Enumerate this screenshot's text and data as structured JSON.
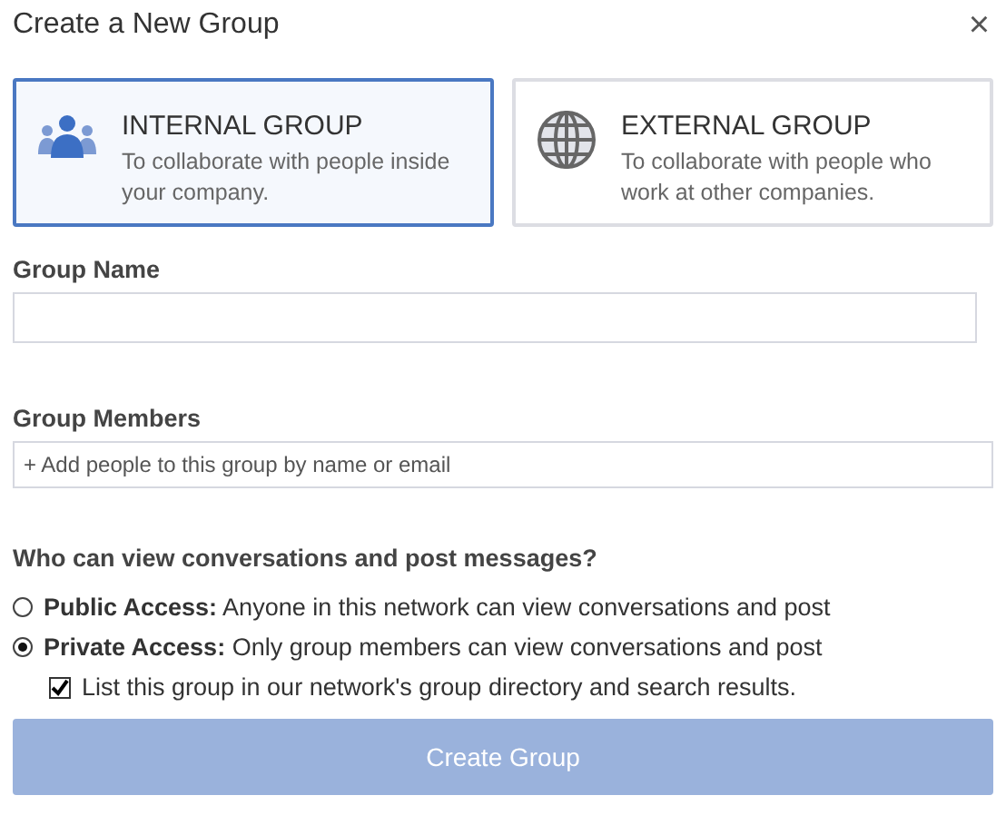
{
  "dialog": {
    "title": "Create a New Group",
    "close": "×"
  },
  "group_types": [
    {
      "kind": "people",
      "title": "INTERNAL GROUP",
      "description": "To collaborate with people inside your company.",
      "selected": true
    },
    {
      "kind": "globe",
      "title": "EXTERNAL GROUP",
      "description": "To collaborate with people who work at other companies.",
      "selected": false
    }
  ],
  "group_name": {
    "label": "Group Name"
  },
  "group_members": {
    "label": "Group Members",
    "placeholder": "+ Add people to this group by name or email"
  },
  "access": {
    "question": "Who can view conversations and post messages?",
    "options": [
      {
        "text": "**Public Access:** Anyone in this network can view conversations and post",
        "selected": false
      },
      {
        "text": "**Private Access:** Only group members can view conversations and post",
        "selected": true
      }
    ],
    "directory": {
      "label": "List this group in our network's group directory and search results.",
      "checked": true
    }
  },
  "submit": {
    "label": "Create Group",
    "disabled": true
  }
}
